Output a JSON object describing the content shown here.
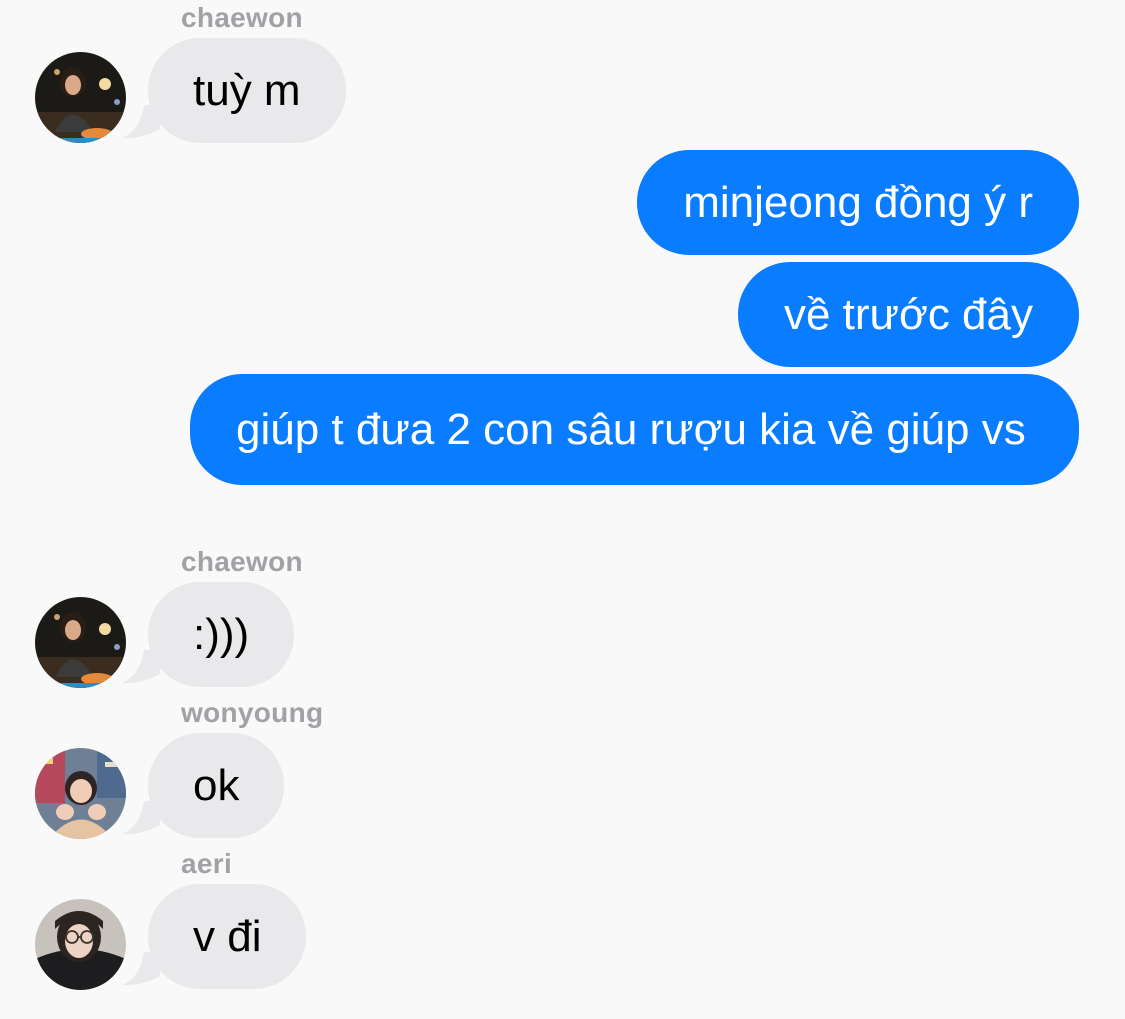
{
  "conversation": {
    "messages": [
      {
        "direction": "incoming",
        "sender": "chaewon",
        "text": "tuỳ m",
        "avatar": "chaewon-avatar"
      },
      {
        "direction": "outgoing",
        "text": "minjeong đồng ý r"
      },
      {
        "direction": "outgoing",
        "text": "về trước đây"
      },
      {
        "direction": "outgoing",
        "text": "giúp t đưa 2 con sâu rượu kia về giúp vs"
      },
      {
        "direction": "incoming",
        "sender": "chaewon",
        "text": ":)))",
        "avatar": "chaewon-avatar"
      },
      {
        "direction": "incoming",
        "sender": "wonyoung",
        "text": "ok",
        "avatar": "wonyoung-avatar"
      },
      {
        "direction": "incoming",
        "sender": "aeri",
        "text": "v đi",
        "avatar": "aeri-avatar"
      }
    ]
  },
  "colors": {
    "background": "#f9f9f9",
    "incoming_bubble": "#e9e9eb",
    "outgoing_bubble": "#0a7cff",
    "sender_name": "#a1a1a6"
  }
}
